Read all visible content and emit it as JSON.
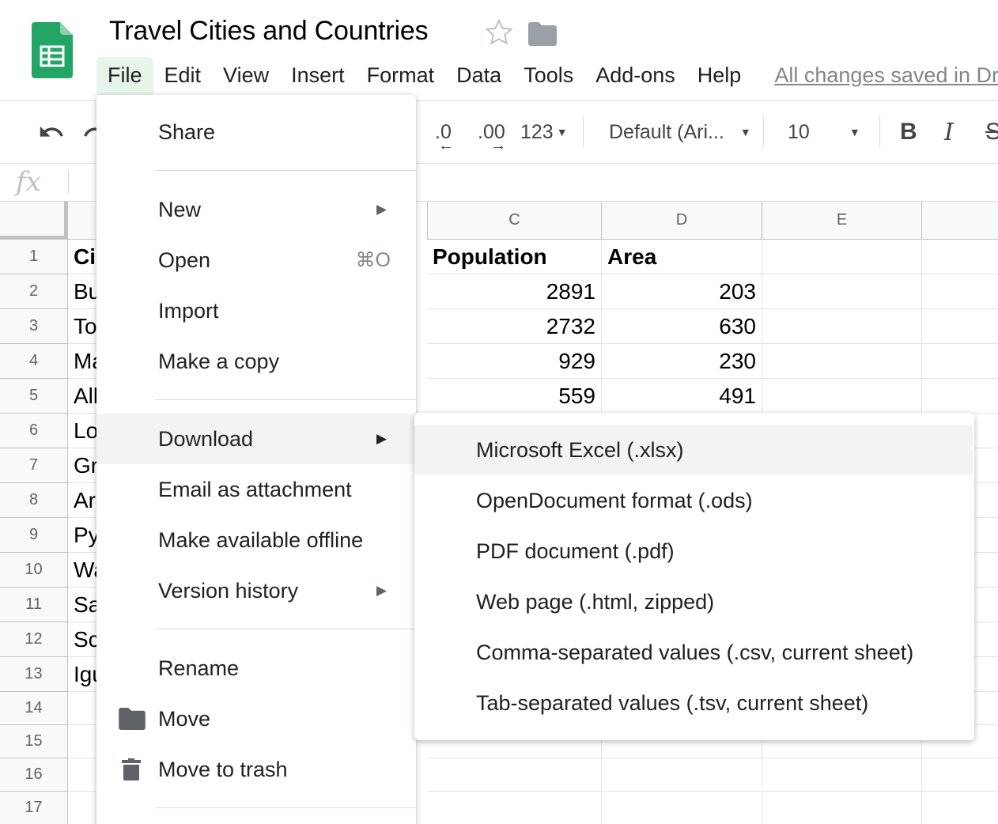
{
  "document": {
    "title": "Travel Cities and Countries"
  },
  "menubar": {
    "items": [
      "File",
      "Edit",
      "View",
      "Insert",
      "Format",
      "Data",
      "Tools",
      "Add-ons",
      "Help"
    ],
    "active": "File",
    "save_status": "All changes saved in Drive"
  },
  "toolbar": {
    "decrease_decimal": ".0",
    "increase_decimal": ".00",
    "more_formats": "123",
    "font": "Default (Ari...",
    "font_size": "10",
    "bold": "B",
    "italic": "I"
  },
  "formula_bar": {
    "label": "fx"
  },
  "grid": {
    "column_headers": [
      "C",
      "D",
      "E"
    ],
    "row_numbers": [
      "1",
      "2",
      "3",
      "4",
      "5",
      "6",
      "7",
      "8",
      "9",
      "10",
      "11",
      "12",
      "13",
      "14",
      "15",
      "16",
      "17"
    ],
    "col_a_visible": [
      "Ci",
      "Bu",
      "To",
      "Ma",
      "All",
      "Lo",
      "Gr",
      "Ar",
      "Py",
      "Wa",
      "Sa",
      "Sc",
      "Igu"
    ],
    "col_c": [
      "Population",
      "2891",
      "2732",
      "929",
      "559"
    ],
    "col_d": [
      "Area",
      "203",
      "630",
      "230",
      "491"
    ]
  },
  "file_menu": {
    "items": {
      "share": "Share",
      "new": "New",
      "open": "Open",
      "open_shortcut": "⌘O",
      "import": "Import",
      "make_copy": "Make a copy",
      "download": "Download",
      "email": "Email as attachment",
      "offline": "Make available offline",
      "version_history": "Version history",
      "rename": "Rename",
      "move": "Move",
      "trash": "Move to trash"
    }
  },
  "download_menu": {
    "items": [
      "Microsoft Excel (.xlsx)",
      "OpenDocument format (.ods)",
      "PDF document (.pdf)",
      "Web page (.html, zipped)",
      "Comma-separated values (.csv, current sheet)",
      "Tab-separated values (.tsv, current sheet)"
    ],
    "highlighted": "Microsoft Excel (.xlsx)"
  },
  "colors": {
    "sheets_green": "#0f9d58",
    "active_menu_bg": "#e6f4ea",
    "hover_bg": "#f1f3f4",
    "grid_line": "#e2e3e3"
  }
}
